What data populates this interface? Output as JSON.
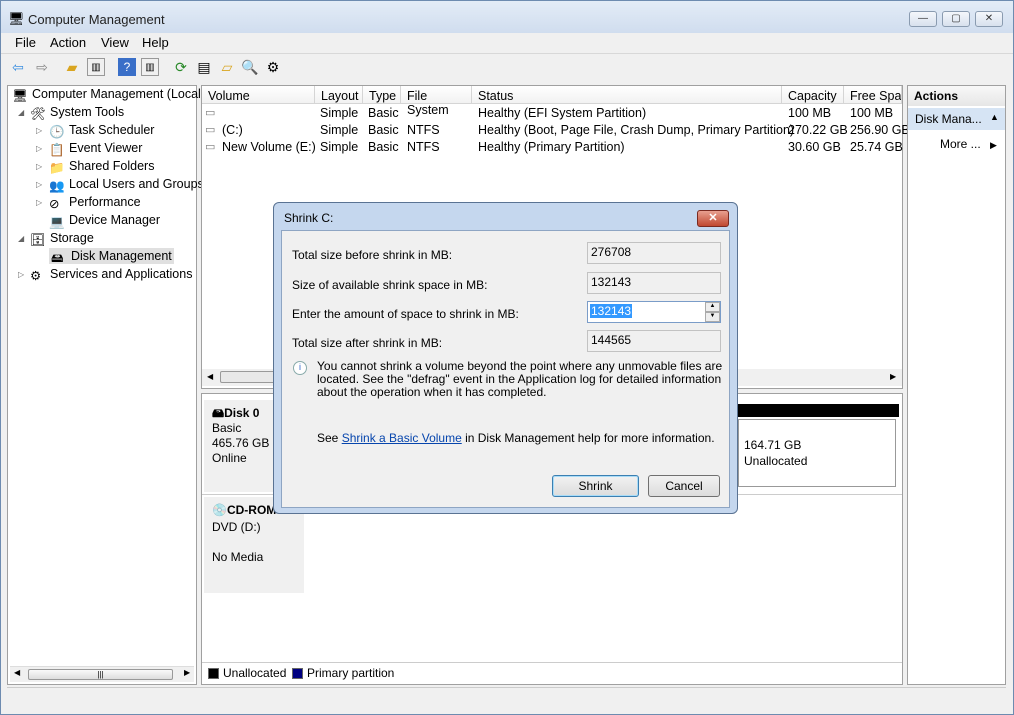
{
  "window": {
    "title": "Computer Management"
  },
  "menu": [
    "File",
    "Action",
    "View",
    "Help"
  ],
  "toolbar_icons": [
    "back-arrow-icon",
    "forward-arrow-icon",
    "up-folder-icon",
    "show-hide-tree-icon",
    "help-icon",
    "show-hide-action-pane-icon",
    "refresh-icon",
    "properties-icon",
    "open-folder-icon",
    "search-icon",
    "settings-icon"
  ],
  "tree": {
    "root": "Computer Management (Local",
    "items": [
      {
        "label": "System Tools",
        "level": 1
      },
      {
        "label": "Task Scheduler",
        "level": 2
      },
      {
        "label": "Event Viewer",
        "level": 2
      },
      {
        "label": "Shared Folders",
        "level": 2
      },
      {
        "label": "Local Users and Groups",
        "level": 2
      },
      {
        "label": "Performance",
        "level": 2
      },
      {
        "label": "Device Manager",
        "level": 2
      },
      {
        "label": "Storage",
        "level": 1
      },
      {
        "label": "Disk Management",
        "level": 2,
        "selected": true
      },
      {
        "label": "Services and Applications",
        "level": 1
      }
    ]
  },
  "volumes": {
    "columns": [
      "Volume",
      "Layout",
      "Type",
      "File System",
      "Status",
      "Capacity",
      "Free Spac"
    ],
    "rows": [
      [
        "",
        "Simple",
        "Basic",
        "",
        "Healthy (EFI System Partition)",
        "100 MB",
        "100 MB"
      ],
      [
        "(C:)",
        "Simple",
        "Basic",
        "NTFS",
        "Healthy (Boot, Page File, Crash Dump, Primary Partition)",
        "270.22 GB",
        "256.90 GB"
      ],
      [
        "New Volume (E:)",
        "Simple",
        "Basic",
        "NTFS",
        "Healthy (Primary Partition)",
        "30.60 GB",
        "25.74 GB"
      ]
    ]
  },
  "disks": [
    {
      "name": "Disk 0",
      "type": "Basic",
      "size": "465.76 GB",
      "state": "Online",
      "partition_size": "164.71 GB",
      "partition_label": "Unallocated"
    },
    {
      "name": "CD-ROM 0",
      "type": "DVD (D:)",
      "state": "No Media"
    }
  ],
  "legend": [
    {
      "label": "Unallocated",
      "color": "#000000"
    },
    {
      "label": "Primary partition",
      "color": "#000080"
    }
  ],
  "actions": {
    "header": "Actions",
    "section": "Disk Mana...",
    "more": "More ..."
  },
  "dialog": {
    "title": "Shrink C:",
    "fields": [
      {
        "label": "Total size before shrink in MB:",
        "value": "276708"
      },
      {
        "label": "Size of available shrink space in MB:",
        "value": "132143"
      },
      {
        "label": "Enter the amount of space to shrink in MB:",
        "value": "132143"
      },
      {
        "label": "Total size after shrink in MB:",
        "value": "144565"
      }
    ],
    "info": "You cannot shrink a volume beyond the point where any unmovable files are located. See the \"defrag\" event in the Application log for detailed information about the operation when it has completed.",
    "help_pre": "See ",
    "help_link": "Shrink a Basic Volume",
    "help_post": " in Disk Management help for more information.",
    "shrink": "Shrink",
    "cancel": "Cancel"
  }
}
